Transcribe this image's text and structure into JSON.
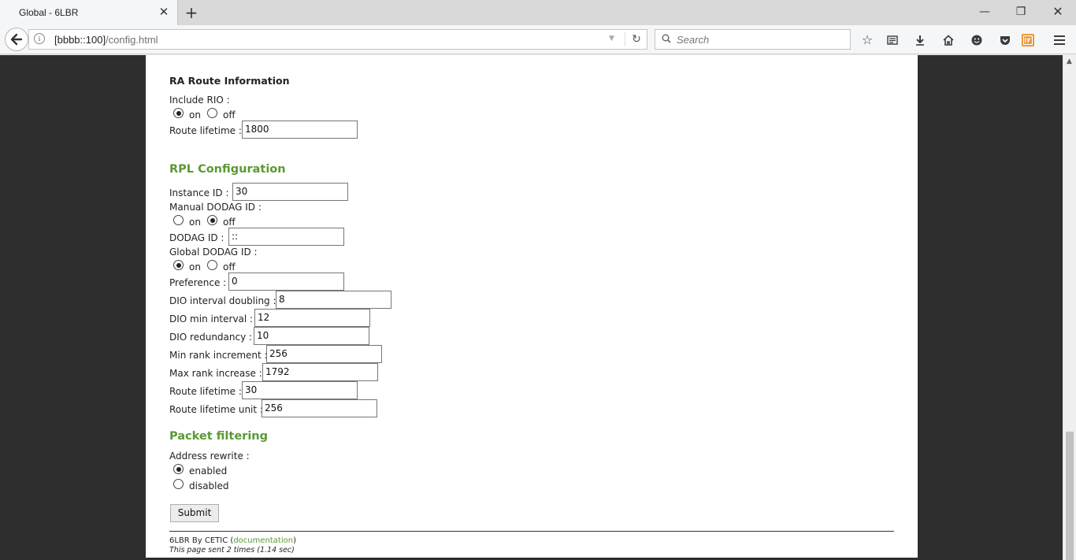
{
  "browser": {
    "tab_title": "Global - 6LBR",
    "url_host": "[bbbb::100]",
    "url_path": "/config.html",
    "search_placeholder": "Search"
  },
  "ra_route": {
    "heading": "RA Route Information",
    "include_rio_label": "Include RIO :",
    "include_rio_value": "on",
    "on_label": "on",
    "off_label": "off",
    "route_lifetime_label": "Route lifetime :",
    "route_lifetime_value": "1800"
  },
  "rpl": {
    "heading": "RPL Configuration",
    "instance_id_label": "Instance ID :",
    "instance_id_value": "30",
    "manual_dodag_label": "Manual DODAG ID :",
    "manual_dodag_value": "off",
    "dodag_id_label": "DODAG ID :",
    "dodag_id_value": "::",
    "global_dodag_label": "Global DODAG ID :",
    "global_dodag_value": "on",
    "preference_label": "Preference :",
    "preference_value": "0",
    "dio_doubling_label": "DIO interval doubling :",
    "dio_doubling_value": "8",
    "dio_min_label": "DIO min interval :",
    "dio_min_value": "12",
    "dio_redundancy_label": "DIO redundancy :",
    "dio_redundancy_value": "10",
    "min_rank_label": "Min rank increment :",
    "min_rank_value": "256",
    "max_rank_label": "Max rank increase :",
    "max_rank_value": "1792",
    "route_lifetime_label": "Route lifetime :",
    "route_lifetime_value": "30",
    "route_lifetime_unit_label": "Route lifetime unit :",
    "route_lifetime_unit_value": "256"
  },
  "packet_filtering": {
    "heading": "Packet filtering",
    "address_rewrite_label": "Address rewrite :",
    "enabled_label": "enabled",
    "disabled_label": "disabled",
    "address_rewrite_value": "enabled"
  },
  "submit_label": "Submit",
  "footer": {
    "brand": "6LBR By CETIC (",
    "doc_link": "documentation",
    "close_paren": ")",
    "stats": "This page sent 2 times (1.14 sec)"
  }
}
